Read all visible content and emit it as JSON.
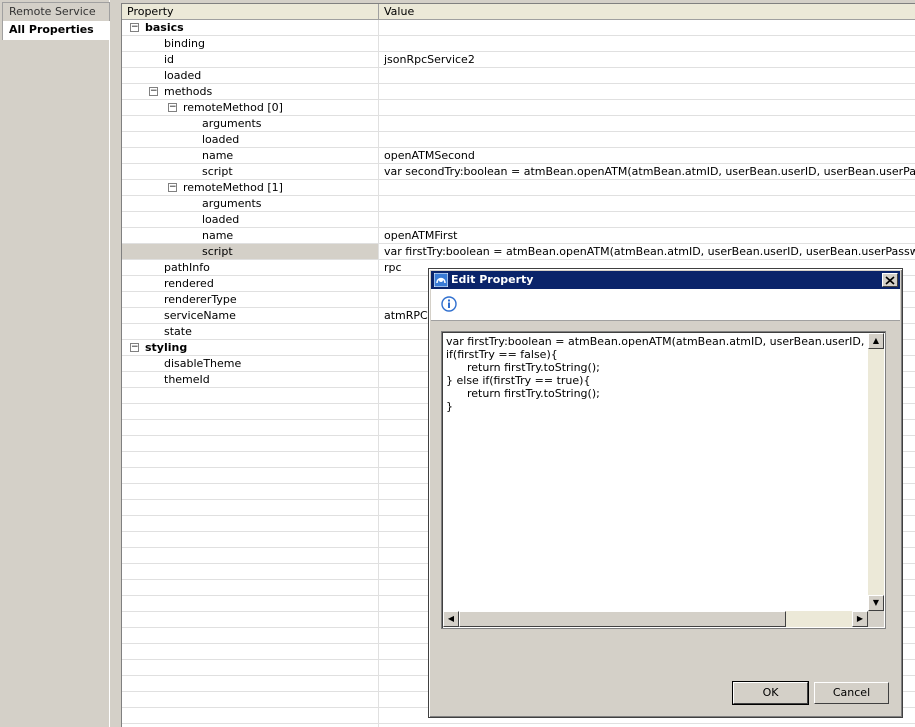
{
  "tabs": [
    {
      "label": "Remote Service"
    },
    {
      "label": "All Properties"
    }
  ],
  "table": {
    "headers": {
      "property": "Property",
      "value": "Value"
    },
    "rows": [
      {
        "label": "basics",
        "value": "",
        "indent": 0,
        "toggle": "−",
        "bold": true
      },
      {
        "label": "binding",
        "value": "",
        "indent": 2
      },
      {
        "label": "id",
        "value": "jsonRpcService2",
        "indent": 2
      },
      {
        "label": "loaded",
        "value": "",
        "indent": 2
      },
      {
        "label": "methods",
        "value": "",
        "indent": 1,
        "toggle": "−"
      },
      {
        "label": "remoteMethod [0]",
        "value": "",
        "indent": 2,
        "toggle": "−"
      },
      {
        "label": "arguments",
        "value": "",
        "indent": 4
      },
      {
        "label": "loaded",
        "value": "",
        "indent": 4
      },
      {
        "label": "name",
        "value": "openATMSecond",
        "indent": 4
      },
      {
        "label": "script",
        "value": "var secondTry:boolean = atmBean.openATM(atmBean.atmID, userBean.userID, userBean.userPassword);if(secondTry",
        "indent": 4
      },
      {
        "label": "remoteMethod [1]",
        "value": "",
        "indent": 2,
        "toggle": "−"
      },
      {
        "label": "arguments",
        "value": "",
        "indent": 4
      },
      {
        "label": "loaded",
        "value": "",
        "indent": 4
      },
      {
        "label": "name",
        "value": "openATMFirst",
        "indent": 4
      },
      {
        "label": "script",
        "value": "var firstTry:boolean = atmBean.openATM(atmBean.atmID, userBean.userID, userBean.userPassword);",
        "indent": 4,
        "selected": true
      },
      {
        "label": "pathInfo",
        "value": "rpc",
        "indent": 2
      },
      {
        "label": "rendered",
        "value": "",
        "indent": 2
      },
      {
        "label": "rendererType",
        "value": "",
        "indent": 2
      },
      {
        "label": "serviceName",
        "value": "atmRPC",
        "indent": 2
      },
      {
        "label": "state",
        "value": "",
        "indent": 2
      },
      {
        "label": "styling",
        "value": "",
        "indent": 0,
        "toggle": "−",
        "bold": true
      },
      {
        "label": "disableTheme",
        "value": "",
        "indent": 2
      },
      {
        "label": "themeId",
        "value": "",
        "indent": 2
      }
    ]
  },
  "dialog": {
    "title": "Edit Property",
    "script_text": "var firstTry:boolean = atmBean.openATM(atmBean.atmID, userBean.userID, userBean.userPassword);\nif(firstTry == false){\n      return firstTry.toString();\n} else if(firstTry == true){\n      return firstTry.toString();\n}",
    "ok_label": "OK",
    "cancel_label": "Cancel"
  },
  "icons": {
    "close": "close-icon",
    "info": "info-icon",
    "app": "app-icon",
    "expand": "minus-toggle-icon"
  },
  "colors": {
    "title_bar": "#0a246a",
    "selection": "#d4d0c8",
    "chrome": "#d4d0c8"
  }
}
